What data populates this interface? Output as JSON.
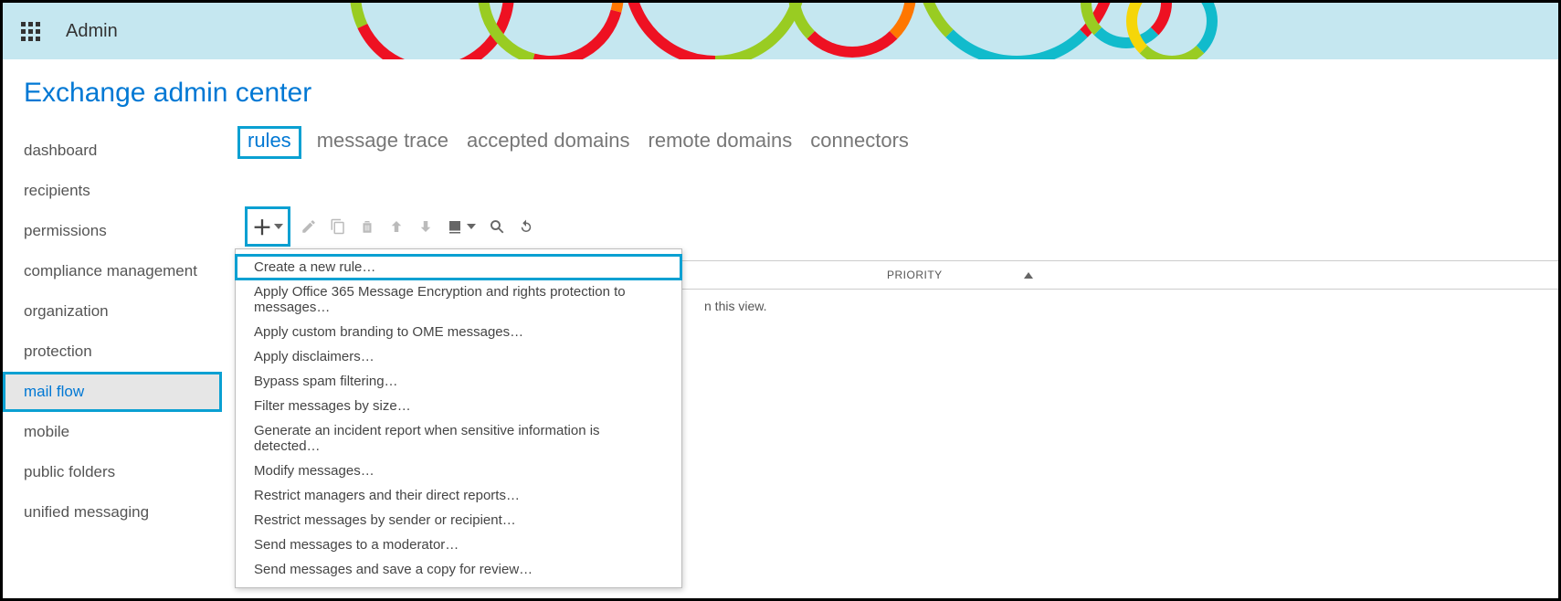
{
  "header": {
    "app_label": "Admin"
  },
  "page_title": "Exchange admin center",
  "sidebar": {
    "items": [
      {
        "label": "dashboard",
        "active": false
      },
      {
        "label": "recipients",
        "active": false
      },
      {
        "label": "permissions",
        "active": false
      },
      {
        "label": "compliance management",
        "active": false
      },
      {
        "label": "organization",
        "active": false
      },
      {
        "label": "protection",
        "active": false
      },
      {
        "label": "mail flow",
        "active": true,
        "highlighted": true
      },
      {
        "label": "mobile",
        "active": false
      },
      {
        "label": "public folders",
        "active": false
      },
      {
        "label": "unified messaging",
        "active": false
      }
    ]
  },
  "tabs": [
    {
      "label": "rules",
      "active": true,
      "highlighted": true
    },
    {
      "label": "message trace",
      "active": false
    },
    {
      "label": "accepted domains",
      "active": false
    },
    {
      "label": "remote domains",
      "active": false
    },
    {
      "label": "connectors",
      "active": false
    }
  ],
  "toolbar": {
    "new_button_highlighted": true
  },
  "table": {
    "columns": [
      {
        "label": "PRIORITY",
        "sort": "asc"
      }
    ],
    "empty_message_suffix": "n this view."
  },
  "dropdown": {
    "items": [
      {
        "label": "Create a new rule…",
        "highlighted": true
      },
      {
        "label": "Apply Office 365 Message Encryption and rights protection to messages…"
      },
      {
        "label": "Apply custom branding to OME messages…"
      },
      {
        "label": "Apply disclaimers…"
      },
      {
        "label": "Bypass spam filtering…"
      },
      {
        "label": "Filter messages by size…"
      },
      {
        "label": "Generate an incident report when sensitive information is detected…"
      },
      {
        "label": "Modify messages…"
      },
      {
        "label": "Restrict managers and their direct reports…"
      },
      {
        "label": "Restrict messages by sender or recipient…"
      },
      {
        "label": "Send messages to a moderator…"
      },
      {
        "label": "Send messages and save a copy for review…"
      }
    ]
  }
}
